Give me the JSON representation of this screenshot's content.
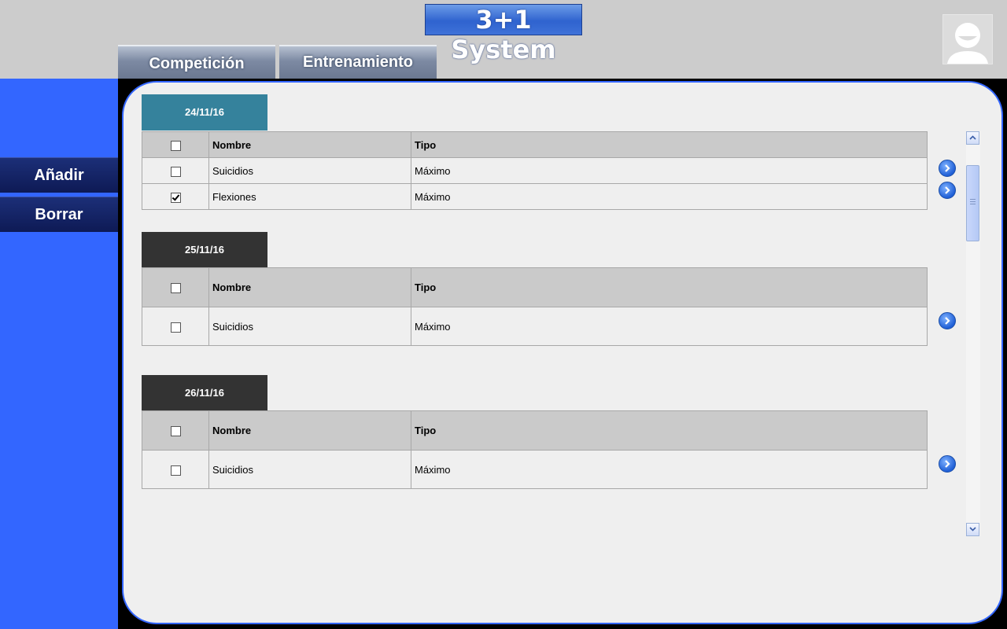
{
  "app": {
    "title": "3+1 System"
  },
  "tabs": [
    {
      "label": "Competición"
    },
    {
      "label": "Entrenamiento"
    }
  ],
  "sidebar": {
    "add_label": "Añadir",
    "delete_label": "Borrar"
  },
  "colors": {
    "accent": "#3366ff",
    "active_date": "#35829c",
    "inactive_date": "#333333"
  },
  "sessions": [
    {
      "date": "24/11/16",
      "header": {
        "name": "Nombre",
        "type": "Tipo",
        "checked": false
      },
      "rows": [
        {
          "name": "Suicidios",
          "type": "Máximo",
          "checked": false
        },
        {
          "name": "Flexiones",
          "type": "Máximo",
          "checked": true
        }
      ]
    },
    {
      "date": "25/11/16",
      "header": {
        "name": "Nombre",
        "type": "Tipo",
        "checked": false
      },
      "rows": [
        {
          "name": "Suicidios",
          "type": "Máximo",
          "checked": false
        }
      ]
    },
    {
      "date": "26/11/16",
      "header": {
        "name": "Nombre",
        "type": "Tipo",
        "checked": false
      },
      "rows": [
        {
          "name": "Suicidios",
          "type": "Máximo",
          "checked": false
        }
      ]
    }
  ]
}
